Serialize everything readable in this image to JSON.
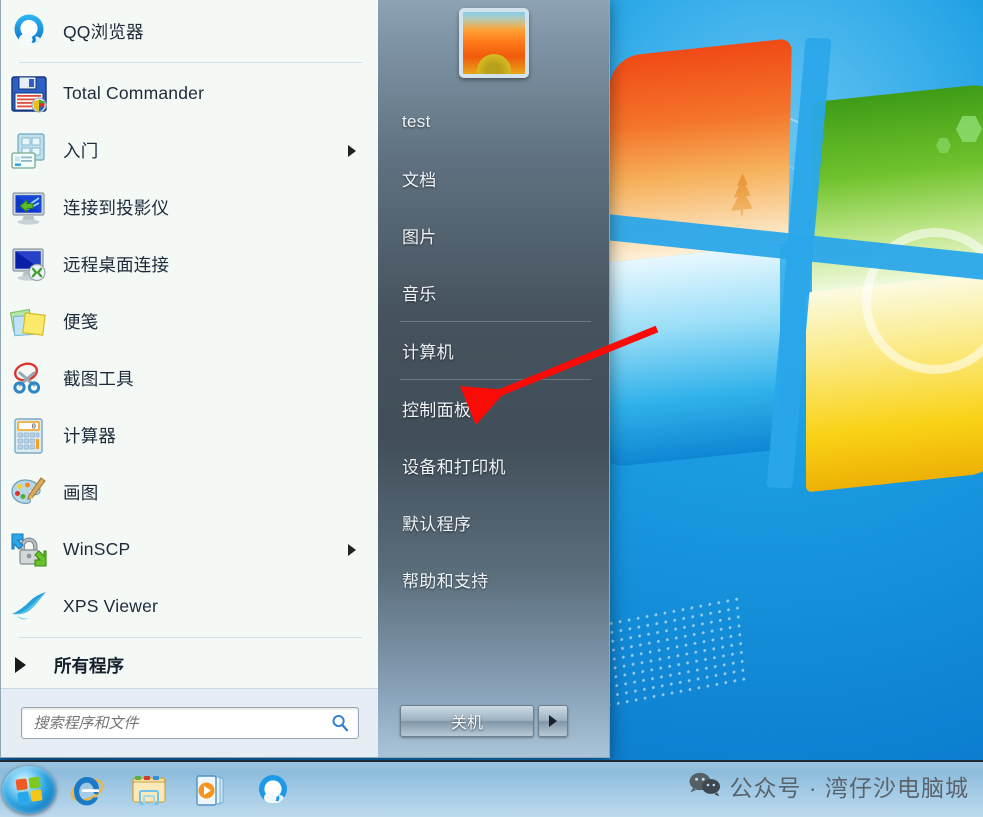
{
  "desktop": {
    "wallpaper_name": "windows-7-default-wallpaper"
  },
  "start_menu": {
    "left_panel": {
      "programs": [
        {
          "label": "QQ浏览器",
          "icon": "qq-browser-icon",
          "has_submenu": false,
          "separator_after": true
        },
        {
          "label": "Total Commander",
          "icon": "floppy-disk-icon",
          "has_submenu": false,
          "separator_after": false
        },
        {
          "label": "入门",
          "icon": "getting-started-icon",
          "has_submenu": true,
          "separator_after": false
        },
        {
          "label": "连接到投影仪",
          "icon": "connect-to-projector-icon",
          "has_submenu": false,
          "separator_after": false
        },
        {
          "label": "远程桌面连接",
          "icon": "remote-desktop-icon",
          "has_submenu": false,
          "separator_after": false
        },
        {
          "label": "便笺",
          "icon": "sticky-notes-icon",
          "has_submenu": false,
          "separator_after": false
        },
        {
          "label": "截图工具",
          "icon": "snipping-tool-icon",
          "has_submenu": false,
          "separator_after": false
        },
        {
          "label": "计算器",
          "icon": "calculator-icon",
          "has_submenu": false,
          "separator_after": false
        },
        {
          "label": "画图",
          "icon": "paint-icon",
          "has_submenu": false,
          "separator_after": false
        },
        {
          "label": "WinSCP",
          "icon": "winscp-lock-icon",
          "has_submenu": true,
          "separator_after": false
        },
        {
          "label": "XPS Viewer",
          "icon": "xps-viewer-icon",
          "has_submenu": false,
          "separator_after": true
        }
      ],
      "all_programs_label": "所有程序",
      "search": {
        "placeholder": "搜索程序和文件",
        "value": "",
        "icon": "search-magnifier-icon"
      }
    },
    "right_panel": {
      "avatar_icon": "user-account-picture",
      "items": [
        {
          "label": "test",
          "separator_after": false
        },
        {
          "label": "文档",
          "separator_after": false
        },
        {
          "label": "图片",
          "separator_after": false
        },
        {
          "label": "音乐",
          "separator_after": true
        },
        {
          "label": "计算机",
          "separator_after": true
        },
        {
          "label": "控制面板",
          "separator_after": false
        },
        {
          "label": "设备和打印机",
          "separator_after": false
        },
        {
          "label": "默认程序",
          "separator_after": false
        },
        {
          "label": "帮助和支持",
          "separator_after": false
        }
      ],
      "shutdown": {
        "label": "关机",
        "arrow_icon": "chevron-right-icon"
      }
    }
  },
  "annotation": {
    "color": "#fb0b08",
    "points_to": "控制面板"
  },
  "taskbar": {
    "start_orb": "windows-start-orb",
    "items": [
      {
        "name": "internet-explorer-icon",
        "label": "Internet Explorer"
      },
      {
        "name": "windows-explorer-icon",
        "label": "Windows Explorer"
      },
      {
        "name": "windows-media-player-icon",
        "label": "Windows Media Player"
      },
      {
        "name": "qq-browser-icon",
        "label": "QQ浏览器"
      }
    ]
  },
  "watermark": {
    "icon": "wechat-icon",
    "text": "公众号 · 湾仔沙电脑城"
  }
}
